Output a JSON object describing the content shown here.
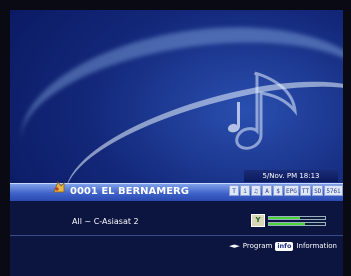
{
  "osd": {
    "datetime": "5/Nov. PM 18:13",
    "channel": {
      "number_name": "0001 EL BERNAMERG",
      "badges": [
        "T",
        "i",
        "♫",
        "A",
        "$",
        "EPG",
        "TT",
        "SD",
        "576i"
      ]
    },
    "satellite": "All ~ C-Asiasat 2",
    "signal": {
      "strength": 0.55,
      "quality": 0.65
    },
    "help": {
      "arrows": "◄►",
      "program_label": "Program",
      "info_key": "info",
      "information_label": "Information"
    }
  }
}
